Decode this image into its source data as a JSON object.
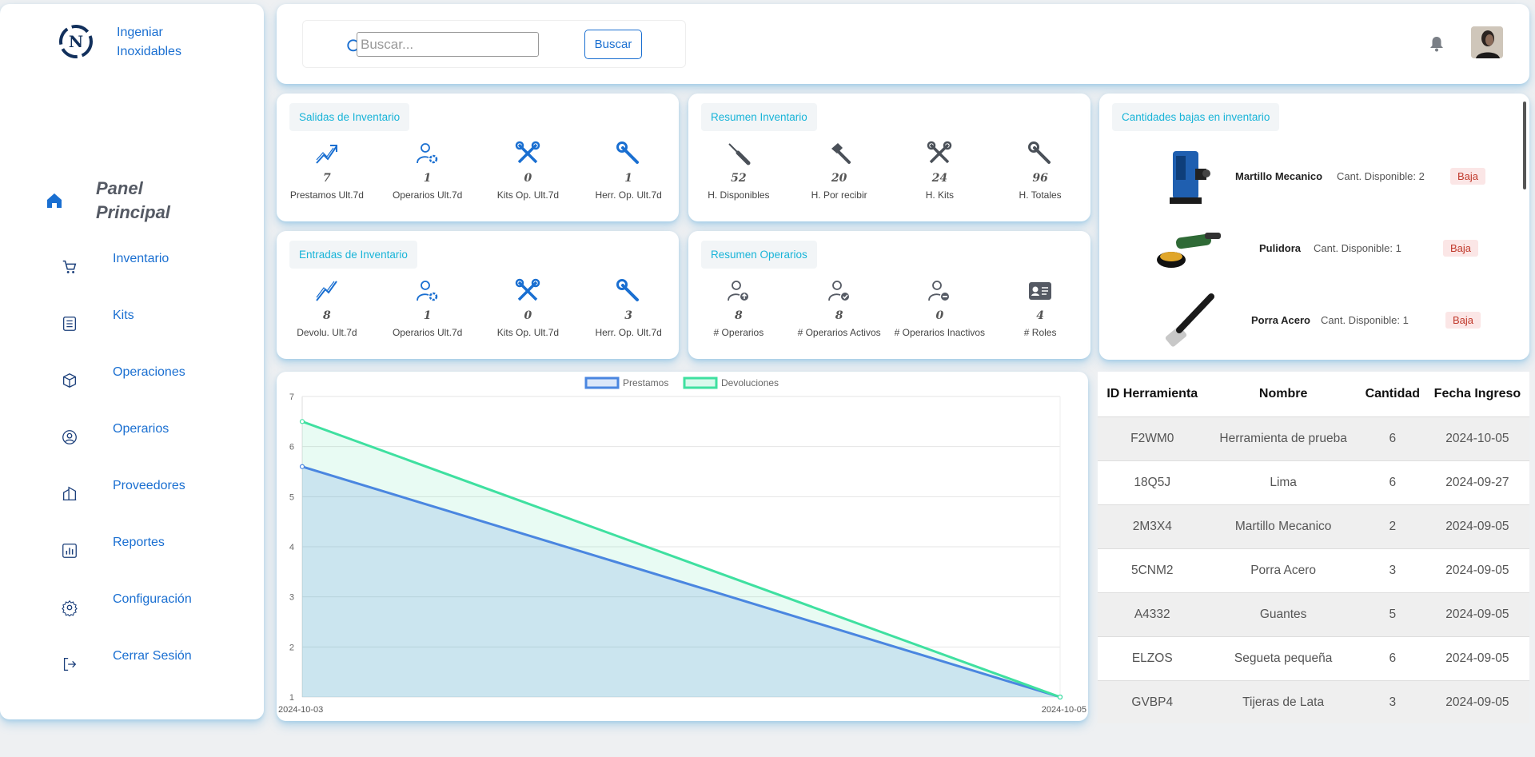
{
  "brand": {
    "name": "Ingeniar Inoxidables"
  },
  "sidebar": {
    "panel_title": "Panel Principal",
    "items": [
      {
        "label": "Inventario",
        "icon": "cart-icon"
      },
      {
        "label": "Kits",
        "icon": "list-icon"
      },
      {
        "label": "Operaciones",
        "icon": "box-icon"
      },
      {
        "label": "Operarios",
        "icon": "user-circle-icon"
      },
      {
        "label": "Proveedores",
        "icon": "building-icon"
      },
      {
        "label": "Reportes",
        "icon": "bar-chart-icon"
      },
      {
        "label": "Configuración",
        "icon": "gear-icon"
      },
      {
        "label": "Cerrar Sesión",
        "icon": "logout-icon"
      }
    ]
  },
  "search": {
    "placeholder": "Buscar...",
    "button": "Buscar"
  },
  "salidas": {
    "title": "Salidas de Inventario",
    "stats": [
      {
        "value": "7",
        "label": "Prestamos Ult.7d"
      },
      {
        "value": "1",
        "label": "Operarios Ult.7d"
      },
      {
        "value": "0",
        "label": "Kits Op. Ult.7d"
      },
      {
        "value": "1",
        "label": "Herr. Op. Ult.7d"
      }
    ]
  },
  "resumen_inv": {
    "title": "Resumen Inventario",
    "stats": [
      {
        "value": "52",
        "label": "H. Disponibles"
      },
      {
        "value": "20",
        "label": "H. Por recibir"
      },
      {
        "value": "24",
        "label": "H. Kits"
      },
      {
        "value": "96",
        "label": "H. Totales"
      }
    ]
  },
  "entradas": {
    "title": "Entradas de Inventario",
    "stats": [
      {
        "value": "8",
        "label": "Devolu. Ult.7d"
      },
      {
        "value": "1",
        "label": "Operarios Ult.7d"
      },
      {
        "value": "0",
        "label": "Kits Op. Ult.7d"
      },
      {
        "value": "3",
        "label": "Herr. Op. Ult.7d"
      }
    ]
  },
  "resumen_op": {
    "title": "Resumen Operarios",
    "stats": [
      {
        "value": "8",
        "label": "# Operarios"
      },
      {
        "value": "8",
        "label": "# Operarios Activos"
      },
      {
        "value": "0",
        "label": "# Operarios Inactivos"
      },
      {
        "value": "4",
        "label": "# Roles"
      }
    ]
  },
  "low_stock": {
    "title": "Cantidades bajas en inventario",
    "items": [
      {
        "name": "Martillo Mecanico",
        "qty": "Cant. Disponible: 2",
        "badge": "Baja"
      },
      {
        "name": "Pulidora",
        "qty": "Cant. Disponible: 1",
        "badge": "Baja"
      },
      {
        "name": "Porra Acero",
        "qty": "Cant. Disponible: 1",
        "badge": "Baja"
      }
    ]
  },
  "chart_data": {
    "type": "area",
    "categories": [
      "2024-10-03",
      "2024-10-05"
    ],
    "series": [
      {
        "name": "Prestamos",
        "values": [
          5.6,
          1
        ],
        "color": "#4a86e0"
      },
      {
        "name": "Devoluciones",
        "values": [
          6.5,
          1
        ],
        "color": "#3fe0a0"
      }
    ],
    "ylim": [
      1,
      7
    ],
    "yticks": [
      1,
      2,
      3,
      4,
      5,
      6,
      7
    ],
    "legend": "top"
  },
  "table": {
    "headers": [
      "ID Herramienta",
      "Nombre",
      "Cantidad",
      "Fecha Ingreso"
    ],
    "rows": [
      [
        "F2WM0",
        "Herramienta de prueba",
        "6",
        "2024-10-05"
      ],
      [
        "18Q5J",
        "Lima",
        "6",
        "2024-09-27"
      ],
      [
        "2M3X4",
        "Martillo Mecanico",
        "2",
        "2024-09-05"
      ],
      [
        "5CNM2",
        "Porra Acero",
        "3",
        "2024-09-05"
      ],
      [
        "A4332",
        "Guantes",
        "5",
        "2024-09-05"
      ],
      [
        "ELZOS",
        "Segueta pequeña",
        "6",
        "2024-09-05"
      ],
      [
        "GVBP4",
        "Tijeras de Lata",
        "3",
        "2024-09-05"
      ]
    ]
  }
}
